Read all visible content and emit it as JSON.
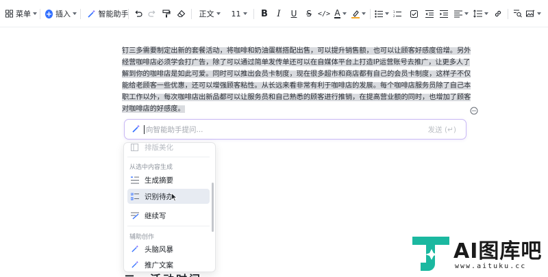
{
  "toolbar": {
    "grid_label": "菜单",
    "insert_label": "插入",
    "ai_label": "智能助手",
    "text_style": "正文",
    "font_size": "11",
    "font_color_letter": "A"
  },
  "document": {
    "paragraph": "钉三多需要制定出新的套餐活动，将咖啡和奶油蛋糕搭配出售，可以提升销售额，也可以让顾客好感度倍增。另外经营咖啡店必须学会打广告，除了可以通过简单发传单还可以在自媒体平台上打造IP运营账号去推广，让更多人了解到你的咖啡店是如此可爱。同时可以推出会员卡制度，现在很多超市和商店都有自己的会员卡制度，这样子不仅能给老顾客一些优惠，还可以增强顾客粘性。从长远来看非常有利于咖啡店的发展。每个咖啡店服务员除了自己本职工作以外，每次咖啡店出新品都可以让服务员和自己熟悉的顾客进行推销，在提高营业额的同时，也增加了顾客对咖啡店的好感度。",
    "next_heading": "二、活动时间"
  },
  "ai_bar": {
    "placeholder": "向智能助手提问...",
    "send_label": "发送 (↵)"
  },
  "menu": {
    "top_item": "排版美化",
    "section1_heading": "从选中内容生成",
    "section1_items": [
      "生成摘要",
      "识别待办",
      "继续写"
    ],
    "section2_heading": "辅助创作",
    "section2_items": [
      "头脑风暴",
      "推广文案"
    ]
  },
  "watermark": {
    "brand": "AI图库吧",
    "url": "www.aituku.cc"
  },
  "colors": {
    "accent": "#3370ff",
    "ai_purple": "#7b61ff",
    "selection": "#d9dbdf",
    "hover": "#e7ebf2",
    "watermark_teal": "#1bb8a0"
  }
}
